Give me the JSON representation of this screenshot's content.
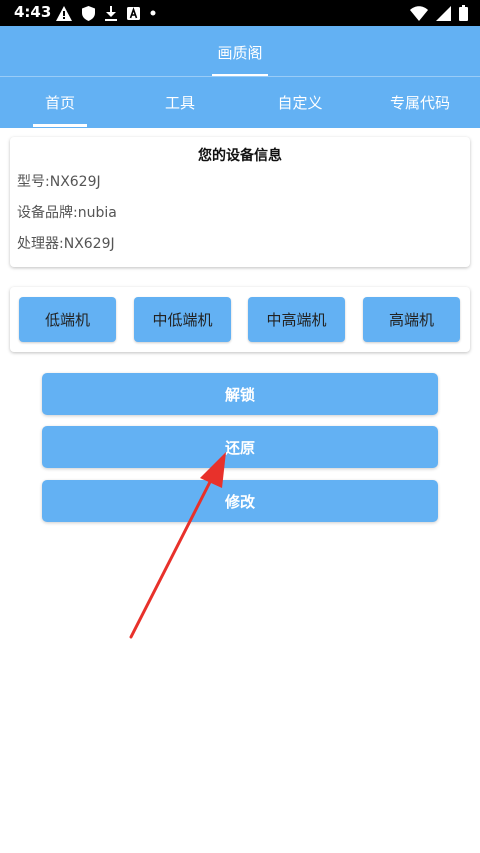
{
  "status_bar": {
    "time": "4:43",
    "left_icons": [
      "warning-icon",
      "shield-icon",
      "download-icon",
      "font-icon",
      "dot-icon"
    ],
    "right_icons": [
      "wifi-icon",
      "signal-icon",
      "battery-icon"
    ]
  },
  "header": {
    "title": "画质阁"
  },
  "tabs": [
    {
      "label": "首页",
      "active": true
    },
    {
      "label": "工具",
      "active": false
    },
    {
      "label": "自定义",
      "active": false
    },
    {
      "label": "专属代码",
      "active": false
    }
  ],
  "device_info": {
    "title": "您的设备信息",
    "model": "型号:NX629J",
    "brand": "设备品牌:nubia",
    "processor": "处理器:NX629J"
  },
  "grades": [
    {
      "label": "低端机"
    },
    {
      "label": "中低端机"
    },
    {
      "label": "中高端机"
    },
    {
      "label": "高端机"
    }
  ],
  "actions": {
    "unlock": "解锁",
    "restore": "还原",
    "modify": "修改"
  },
  "colors": {
    "primary": "#63b1f3",
    "annotation_arrow": "#e8312b"
  }
}
